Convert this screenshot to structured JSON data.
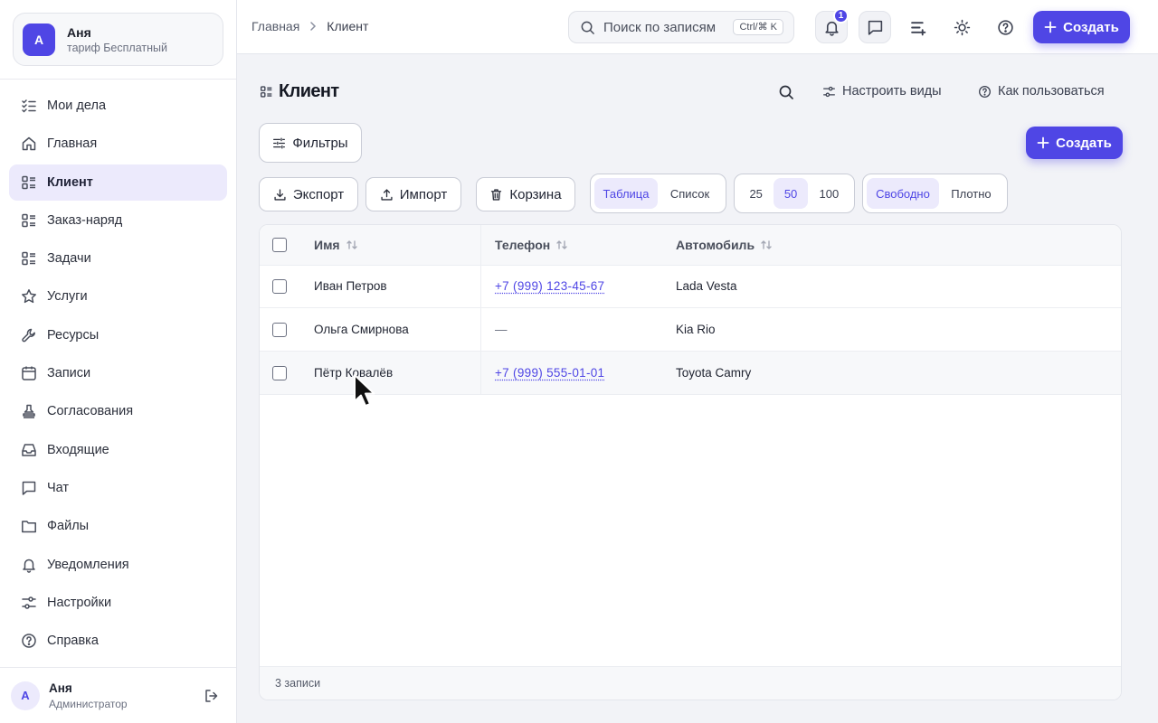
{
  "account": {
    "initial": "А",
    "name": "Аня",
    "plan": "тариф Бесплатный"
  },
  "nav": [
    {
      "label": "Мои дела",
      "icon": "checklist-icon"
    },
    {
      "label": "Главная",
      "icon": "home-icon"
    },
    {
      "label": "Клиент",
      "icon": "table-list-icon",
      "active": true
    },
    {
      "label": "Заказ-наряд",
      "icon": "table-list-icon"
    },
    {
      "label": "Задачи",
      "icon": "table-list-icon"
    },
    {
      "label": "Услуги",
      "icon": "star-icon"
    },
    {
      "label": "Ресурсы",
      "icon": "wrench-icon"
    },
    {
      "label": "Записи",
      "icon": "calendar-icon"
    },
    {
      "label": "Согласования",
      "icon": "stamp-icon"
    },
    {
      "label": "Входящие",
      "icon": "inbox-icon"
    },
    {
      "label": "Чат",
      "icon": "chat-icon"
    },
    {
      "label": "Файлы",
      "icon": "folder-icon"
    },
    {
      "label": "Уведомления",
      "icon": "bell-icon"
    },
    {
      "label": "Настройки",
      "icon": "sliders-icon"
    },
    {
      "label": "Справка",
      "icon": "help-icon"
    }
  ],
  "user": {
    "initial": "А",
    "name": "Аня",
    "role": "Администратор"
  },
  "breadcrumb": {
    "home": "Главная",
    "current": "Клиент"
  },
  "search": {
    "placeholder": "Поиск по записям",
    "shortcut": "Ctrl/⌘ K"
  },
  "notifications": {
    "count": "1"
  },
  "topbar": {
    "create_label": "Создать"
  },
  "page": {
    "title": "Клиент",
    "configure_views": "Настроить виды",
    "how_to_use": "Как пользоваться",
    "filters": "Фильтры",
    "create_label": "Создать",
    "export": "Экспорт",
    "import": "Импорт",
    "trash": "Корзина"
  },
  "view_modes": {
    "options": [
      "Таблица",
      "Список"
    ],
    "selected": "Таблица"
  },
  "page_sizes": {
    "options": [
      "25",
      "50",
      "100"
    ],
    "selected": "50"
  },
  "density": {
    "options": [
      "Свободно",
      "Плотно"
    ],
    "selected": "Свободно"
  },
  "table": {
    "columns": [
      "Имя",
      "Телефон",
      "Автомобиль"
    ],
    "rows": [
      {
        "name": "Иван Петров",
        "phone": "+7 (999) 123-45-67",
        "car": "Lada Vesta"
      },
      {
        "name": "Ольга Смирнова",
        "phone": "—",
        "car": "Kia Rio"
      },
      {
        "name": "Пётр Ковалёв",
        "phone": "+7 (999) 555-01-01",
        "car": "Toyota Camry"
      }
    ],
    "footer": "3 записи"
  },
  "colors": {
    "accent": "#4f46e5",
    "accent_soft": "#eceafc"
  }
}
